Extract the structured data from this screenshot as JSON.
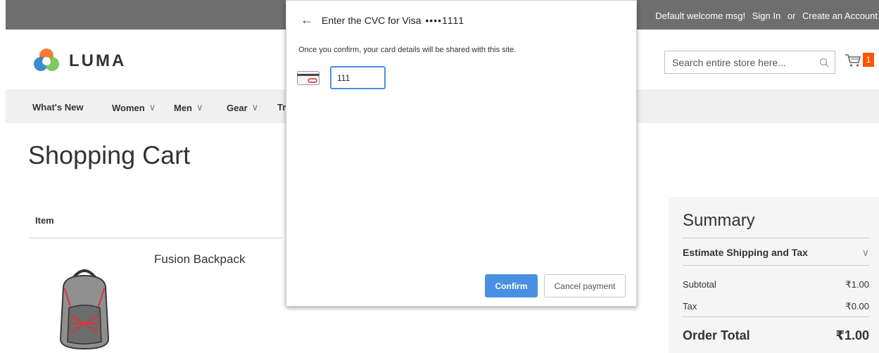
{
  "header": {
    "welcome": "Default welcome msg!",
    "sign_in": "Sign In",
    "or": "or",
    "create_account": "Create an Account",
    "logo_text": "LUMA",
    "search_placeholder": "Search entire store here...",
    "cart_count": "1"
  },
  "nav": {
    "items": [
      {
        "label": "What's New"
      },
      {
        "label": "Women"
      },
      {
        "label": "Men"
      },
      {
        "label": "Gear"
      },
      {
        "label": "Tr"
      }
    ]
  },
  "page": {
    "title": "Shopping Cart",
    "item_column": "Item",
    "product_name": "Fusion Backpack"
  },
  "summary": {
    "title": "Summary",
    "estimate": "Estimate Shipping and Tax",
    "subtotal_label": "Subtotal",
    "subtotal_value": "₹1.00",
    "tax_label": "Tax",
    "tax_value": "₹0.00",
    "total_label": "Order Total",
    "total_value": "₹1.00"
  },
  "dialog": {
    "title": "Enter the CVC for Visa",
    "card_mask": "••••1111",
    "description": "Once you confirm, your card details will be shared with this site.",
    "cvc_value": "111",
    "confirm_label": "Confirm",
    "cancel_label": "Cancel payment"
  },
  "colors": {
    "topbar": "#6e6e6e",
    "accent_blue": "#4a90e2",
    "cart_badge": "#ff5501"
  }
}
